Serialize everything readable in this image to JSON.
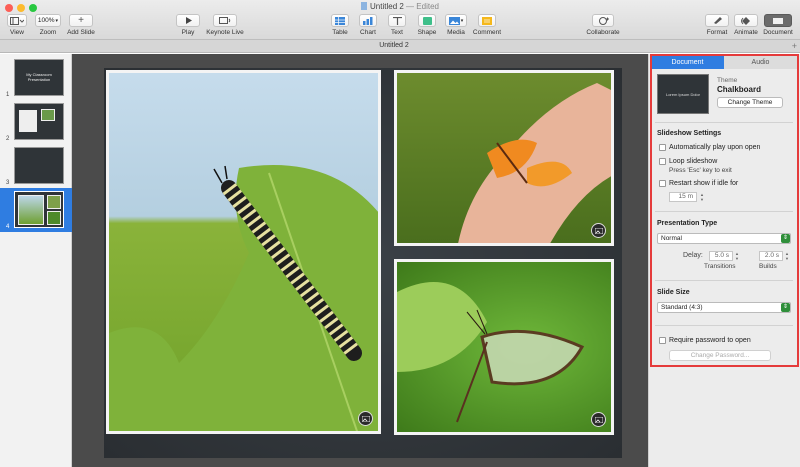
{
  "window": {
    "title": "Untitled 2",
    "status": "Edited",
    "separator": "—"
  },
  "toolbar": {
    "view_label": "View",
    "zoom_value": "100%",
    "zoom_label": "Zoom",
    "add_slide_label": "Add Slide",
    "play_label": "Play",
    "keynote_live_label": "Keynote Live",
    "table_label": "Table",
    "chart_label": "Chart",
    "text_label": "Text",
    "shape_label": "Shape",
    "media_label": "Media",
    "comment_label": "Comment",
    "collaborate_label": "Collaborate",
    "format_label": "Format",
    "animate_label": "Animate",
    "document_label": "Document"
  },
  "tabstrip": {
    "title": "Untitled 2",
    "add_tab": "+"
  },
  "navigator": {
    "slides": [
      {
        "number": "1",
        "thumb_text": "My Classroom Presentation"
      },
      {
        "number": "2",
        "thumb_text": ""
      },
      {
        "number": "3",
        "thumb_text": ""
      },
      {
        "number": "4",
        "thumb_text": ""
      }
    ],
    "selected_index": 3
  },
  "inspector": {
    "tabs": [
      "Document",
      "Audio"
    ],
    "active_tab": "Document",
    "theme": {
      "caption": "Theme",
      "name": "Chalkboard",
      "preview_text": "Lorem Ipsum Dolor",
      "change_button": "Change Theme"
    },
    "slideshow": {
      "heading": "Slideshow Settings",
      "auto_play": "Automatically play upon open",
      "loop": "Loop slideshow",
      "loop_hint": "Press 'Esc' key to exit",
      "restart": "Restart show if idle for",
      "idle_value": "15 m"
    },
    "presentation_type": {
      "heading": "Presentation Type",
      "selected": "Normal",
      "delay_label": "Delay:",
      "transitions_value": "5.0 s",
      "builds_value": "2.0 s",
      "transitions_label": "Transitions",
      "builds_label": "Builds"
    },
    "slide_size": {
      "heading": "Slide Size",
      "selected": "Standard (4:3)"
    },
    "password": {
      "require_label": "Require password to open",
      "change_button": "Change Password..."
    }
  },
  "colors": {
    "accent": "#2f7de1",
    "highlight": "#e53b3b",
    "select_arrow": "#2f8f3a",
    "close": "#fc5f57",
    "minimize": "#fdbb2e",
    "zoom": "#28c840"
  }
}
